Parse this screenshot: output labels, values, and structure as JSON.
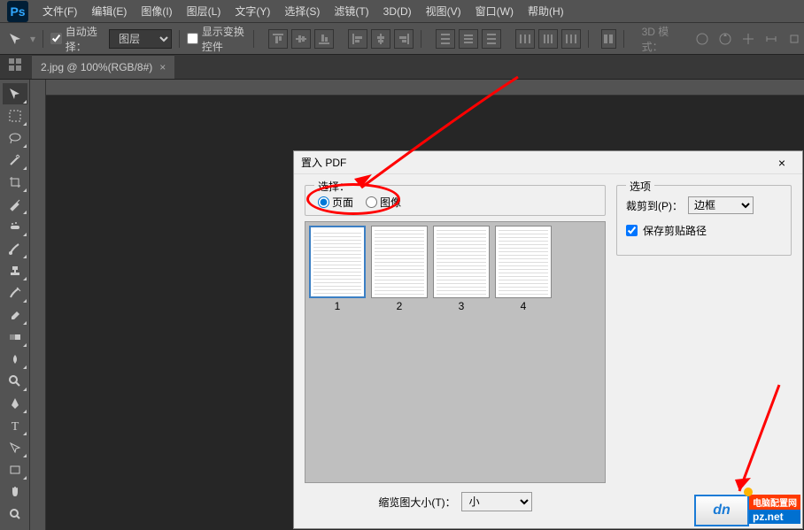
{
  "app": {
    "logo": "Ps"
  },
  "menubar": {
    "items": [
      "文件(F)",
      "编辑(E)",
      "图像(I)",
      "图层(L)",
      "文字(Y)",
      "选择(S)",
      "滤镜(T)",
      "3D(D)",
      "视图(V)",
      "窗口(W)",
      "帮助(H)"
    ]
  },
  "options": {
    "auto_select_label": "自动选择：",
    "auto_select_checked": true,
    "auto_select_target": "图层",
    "show_transform_label": "显示变换控件",
    "show_transform_checked": false,
    "mode_3d_label": "3D 模式："
  },
  "tab": {
    "title": "2.jpg @ 100%(RGB/8#)",
    "close": "×"
  },
  "tools": [
    "move",
    "marquee",
    "lasso",
    "wand",
    "crop",
    "eyedropper",
    "healing",
    "brush",
    "stamp",
    "history",
    "eraser",
    "gradient",
    "blur",
    "dodge",
    "pen",
    "type",
    "path",
    "rectangle",
    "hand",
    "zoom"
  ],
  "dialog": {
    "title": "置入 PDF",
    "close": "×",
    "select_group_label": "选择：",
    "radio_page": "页面",
    "radio_image": "图像",
    "radio_checked": "page",
    "thumb_size_label": "缩览图大小(T)：",
    "thumb_size_value": "小",
    "pages": [
      "1",
      "2",
      "3",
      "4"
    ],
    "selected_page": 0,
    "options_label": "选项",
    "crop_to_label": "裁剪到(P)：",
    "crop_to_value": "边框",
    "preserve_clip_label": "保存剪贴路径",
    "preserve_clip_checked": true
  },
  "watermark": {
    "logo": "dn",
    "cn": "电脑配置网",
    "net": "pz.net"
  }
}
